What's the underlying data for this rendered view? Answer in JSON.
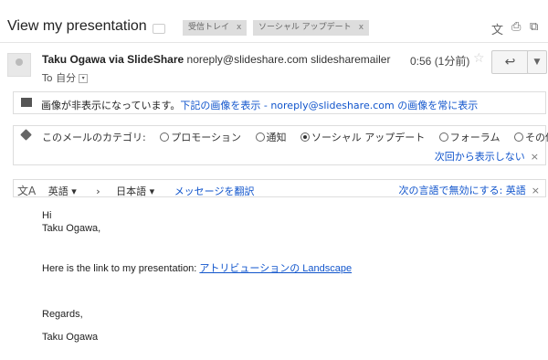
{
  "subject": "View my presentation",
  "labels": [
    {
      "text": "受信トレイ",
      "close": "x"
    },
    {
      "text": "ソーシャル アップデート",
      "close": "x"
    }
  ],
  "top_icons": [
    "translate-icon",
    "print-icon",
    "new-window-icon"
  ],
  "message": {
    "sender_name": "Taku Ogawa via SlideShare",
    "sender_email": "noreply@slideshare.com slidesharemailer",
    "time": "0:56 (1分前)",
    "to": "To 自分"
  },
  "image_notice": {
    "bold": "画像が非表示になっています。",
    "link_show": "下記の画像を表示",
    "sep": " - ",
    "link_always": "noreply@slideshare.com の画像を常に表示"
  },
  "category": {
    "prompt": "このメールのカテゴリ:",
    "options": [
      "プロモーション",
      "通知",
      "ソーシャル アップデート",
      "フォーラム",
      "その他"
    ],
    "selected": "ソーシャル アップデート",
    "hide": "次回から表示しない",
    "close": "×"
  },
  "translate_bar": {
    "from": "英語 ▾",
    "arrow": "›",
    "to": "日本語 ▾",
    "action": "メッセージを翻訳",
    "disable": "次の言語で無効にする: 英語",
    "close": "×"
  },
  "body": {
    "line1": "Hi",
    "line2": "Taku Ogawa,",
    "link_prefix": "Here is the link to my presentation: ",
    "link_text": "アトリビューションの Landscape",
    "regards": "Regards,",
    "signature": "Taku Ogawa"
  }
}
